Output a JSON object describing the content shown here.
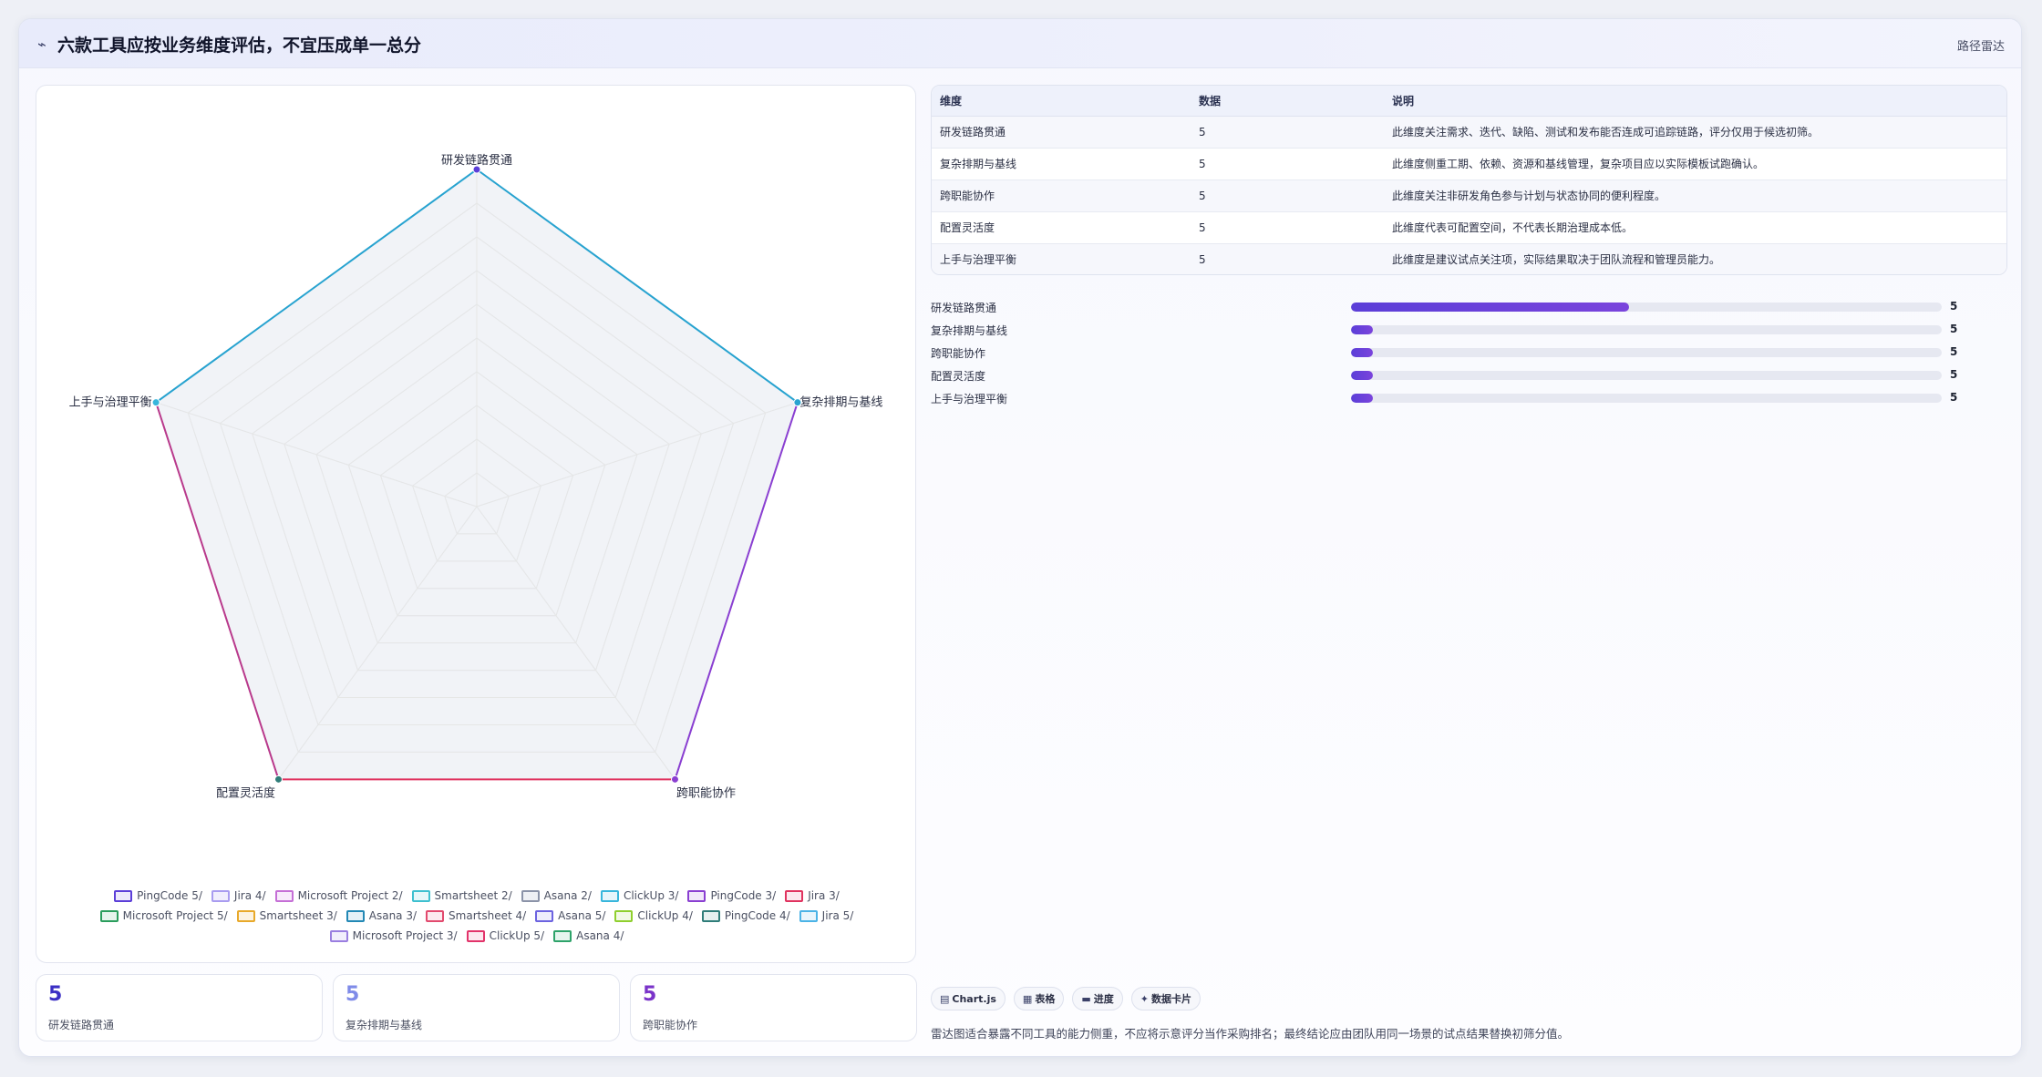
{
  "header": {
    "icon": "trend-icon",
    "title": "六款工具应按业务维度评估，不宜压成单一总分",
    "tag": "路径雷达"
  },
  "chart_data": {
    "type": "radar",
    "axes": [
      "研发链路贯通",
      "复杂排期与基线",
      "跨职能协作",
      "配置灵活度",
      "上手与治理平衡"
    ],
    "rmax": 5,
    "grid_levels": 10,
    "series": [
      {
        "name": "PingCode 5/",
        "color": "#5b3ed8",
        "fill": "#ece8fb",
        "values": [
          5,
          5,
          5,
          5,
          5
        ]
      },
      {
        "name": "Jira 4/",
        "color": "#a99cf0",
        "fill": "#f1eefd",
        "values": [
          5,
          5,
          5,
          5,
          5
        ]
      },
      {
        "name": "Microsoft Project 2/",
        "color": "#c56fd6",
        "fill": "#f8ebfb",
        "values": [
          5,
          5,
          5,
          5,
          5
        ]
      },
      {
        "name": "Smartsheet 2/",
        "color": "#3ec0cf",
        "fill": "#e6f7f9",
        "values": [
          5,
          5,
          5,
          5,
          5
        ]
      },
      {
        "name": "Asana 2/",
        "color": "#8b93a8",
        "fill": "#eef0f4",
        "values": [
          5,
          5,
          5,
          5,
          5
        ]
      },
      {
        "name": "ClickUp 3/",
        "color": "#38b6dc",
        "fill": "#e6f5fb",
        "values": [
          5,
          5,
          5,
          5,
          5
        ]
      },
      {
        "name": "PingCode 3/",
        "color": "#8a3fd1",
        "fill": "#f1e8fa",
        "values": [
          5,
          5,
          5,
          5,
          5
        ]
      },
      {
        "name": "Jira 3/",
        "color": "#e0335f",
        "fill": "#fce8ee",
        "values": [
          5,
          5,
          5,
          5,
          5
        ]
      },
      {
        "name": "Microsoft Project 5/",
        "color": "#2a9d5c",
        "fill": "#e6f4ec",
        "values": [
          5,
          5,
          5,
          5,
          5
        ]
      },
      {
        "name": "Smartsheet 3/",
        "color": "#e8a92a",
        "fill": "#fcf3e2",
        "values": [
          5,
          5,
          5,
          5,
          5
        ]
      },
      {
        "name": "Asana 3/",
        "color": "#2288b5",
        "fill": "#e5f1f7",
        "values": [
          5,
          5,
          5,
          5,
          5
        ]
      },
      {
        "name": "Smartsheet 4/",
        "color": "#e24a6e",
        "fill": "#fcebef",
        "values": [
          5,
          5,
          5,
          5,
          5
        ]
      },
      {
        "name": "Asana 5/",
        "color": "#6c63e0",
        "fill": "#eeedfc",
        "values": [
          5,
          5,
          5,
          5,
          5
        ]
      },
      {
        "name": "ClickUp 4/",
        "color": "#8fcf2e",
        "fill": "#f2f9e6",
        "values": [
          5,
          5,
          5,
          5,
          5
        ]
      },
      {
        "name": "PingCode 4/",
        "color": "#2f7d79",
        "fill": "#e6f1f0",
        "values": [
          5,
          5,
          5,
          5,
          5
        ]
      },
      {
        "name": "Jira 5/",
        "color": "#4bb3e6",
        "fill": "#e8f5fc",
        "values": [
          5,
          5,
          5,
          5,
          5
        ]
      },
      {
        "name": "Microsoft Project 3/",
        "color": "#9a7ee0",
        "fill": "#f2eefc",
        "values": [
          5,
          5,
          5,
          5,
          5
        ]
      },
      {
        "name": "ClickUp 5/",
        "color": "#e2336a",
        "fill": "#fce8ef",
        "values": [
          5,
          5,
          5,
          5,
          5
        ]
      },
      {
        "name": "Asana 4/",
        "color": "#2ea36a",
        "fill": "#e6f5ee",
        "values": [
          5,
          5,
          5,
          5,
          5
        ]
      }
    ],
    "outline_edges": [
      {
        "from": 0,
        "to": 1,
        "color": "#27a3d0"
      },
      {
        "from": 1,
        "to": 2,
        "color": "#8a3fd1"
      },
      {
        "from": 2,
        "to": 3,
        "color": "#e0335f"
      },
      {
        "from": 3,
        "to": 4,
        "color": "#b93a8c"
      },
      {
        "from": 4,
        "to": 0,
        "color": "#27a3d0"
      }
    ],
    "vertex_colors": [
      "#5b3ed8",
      "#27a3d0",
      "#8a3fd1",
      "#2f7d79",
      "#38b6dc"
    ]
  },
  "stats": [
    {
      "value": "5",
      "label": "研发链路贯通",
      "color": "#3b2fc4"
    },
    {
      "value": "5",
      "label": "复杂排期与基线",
      "color": "#7f8be8"
    },
    {
      "value": "5",
      "label": "跨职能协作",
      "color": "#7a33c9"
    }
  ],
  "table": {
    "headers": [
      "维度",
      "数据",
      "说明"
    ],
    "rows": [
      [
        "研发链路贯通",
        "5",
        "此维度关注需求、迭代、缺陷、测试和发布能否连成可追踪链路，评分仅用于候选初筛。"
      ],
      [
        "复杂排期与基线",
        "5",
        "此维度侧重工期、依赖、资源和基线管理，复杂项目应以实际模板试跑确认。"
      ],
      [
        "跨职能协作",
        "5",
        "此维度关注非研发角色参与计划与状态协同的便利程度。"
      ],
      [
        "配置灵活度",
        "5",
        "此维度代表可配置空间，不代表长期治理成本低。"
      ],
      [
        "上手与治理平衡",
        "5",
        "此维度是建议试点关注项，实际结果取决于团队流程和管理员能力。"
      ]
    ]
  },
  "progress": [
    {
      "label": "研发链路贯通",
      "value": "5",
      "fraction": 0.47
    },
    {
      "label": "复杂排期与基线",
      "value": "5",
      "fraction": 0.037
    },
    {
      "label": "跨职能协作",
      "value": "5",
      "fraction": 0.037
    },
    {
      "label": "配置灵活度",
      "value": "5",
      "fraction": 0.037
    },
    {
      "label": "上手与治理平衡",
      "value": "5",
      "fraction": 0.037
    }
  ],
  "chips": [
    {
      "icon": "chart-icon",
      "glyph": "▤",
      "label": "Chart.js"
    },
    {
      "icon": "table-icon",
      "glyph": "▦",
      "label": "表格"
    },
    {
      "icon": "progress-icon",
      "glyph": "▬",
      "label": "进度"
    },
    {
      "icon": "card-icon",
      "glyph": "✦",
      "label": "数据卡片"
    }
  ],
  "footnote": "雷达图适合暴露不同工具的能力侧重，不应将示意评分当作采购排名；最终结论应由团队用同一场景的试点结果替换初筛分值。"
}
